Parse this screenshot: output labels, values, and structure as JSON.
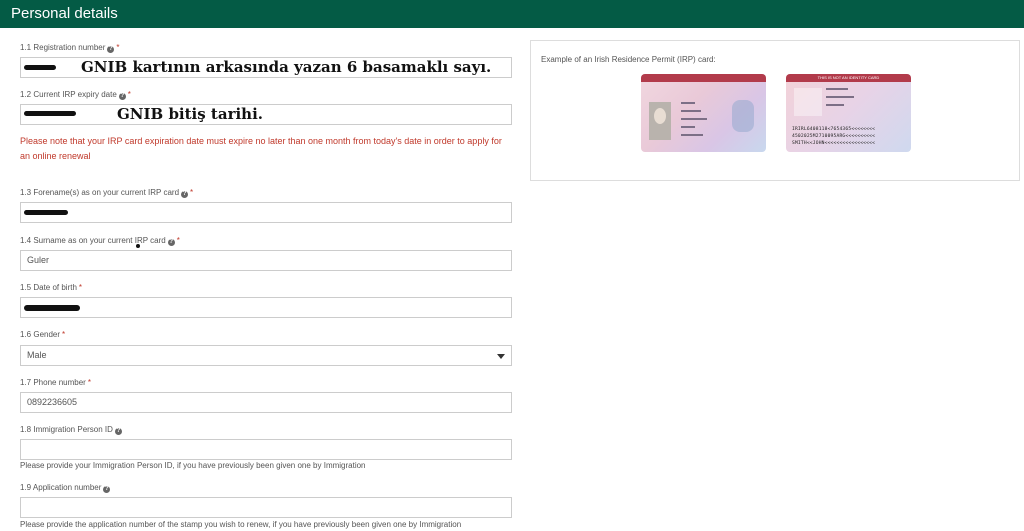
{
  "header": {
    "title": "Personal details"
  },
  "fields": {
    "registration": {
      "label": "1.1 Registration number",
      "value": "",
      "annotation": "GNIB kartının arkasında yazan 6 basamaklı sayı."
    },
    "expiry": {
      "label": "1.2 Current IRP expiry date",
      "value": "",
      "annotation": "GNIB bitiş tarihi."
    },
    "expiry_warning": "Please note that your IRP card expiration date must expire no later than one month from today's date in order to apply for an online renewal",
    "forename": {
      "label": "1.3 Forename(s) as on your current IRP card",
      "value": ""
    },
    "surname": {
      "label": "1.4 Surname as on your current IRP card",
      "value": "Guler"
    },
    "dob": {
      "label": "1.5 Date of birth",
      "value": ""
    },
    "gender": {
      "label": "1.6 Gender",
      "value": "Male"
    },
    "phone": {
      "label": "1.7 Phone number",
      "value": "0892236605"
    },
    "immigration_id": {
      "label": "1.8 Immigration Person ID",
      "value": "",
      "help": "Please provide your Immigration Person ID, if you have previously been given one by Immigration"
    },
    "application_number": {
      "label": "1.9 Application number",
      "value": "",
      "help": "Please provide the application number of the stamp you wish to renew, if you have previously been given one by Immigration"
    }
  },
  "example": {
    "title": "Example of an Irish Residence Permit (IRP) card:",
    "back_card_header": "THIS IS NOT AN IDENTITY CARD",
    "mrz_line1": "IRIRL6408118<7654365<<<<<<<<",
    "mrz_line2": "4502025M2710095ARG<<<<<<<<<<",
    "mrz_line3": "SMITH<<JOHN<<<<<<<<<<<<<<<<<"
  },
  "colors": {
    "header_bg": "#045b45",
    "warning": "#c0392b"
  }
}
